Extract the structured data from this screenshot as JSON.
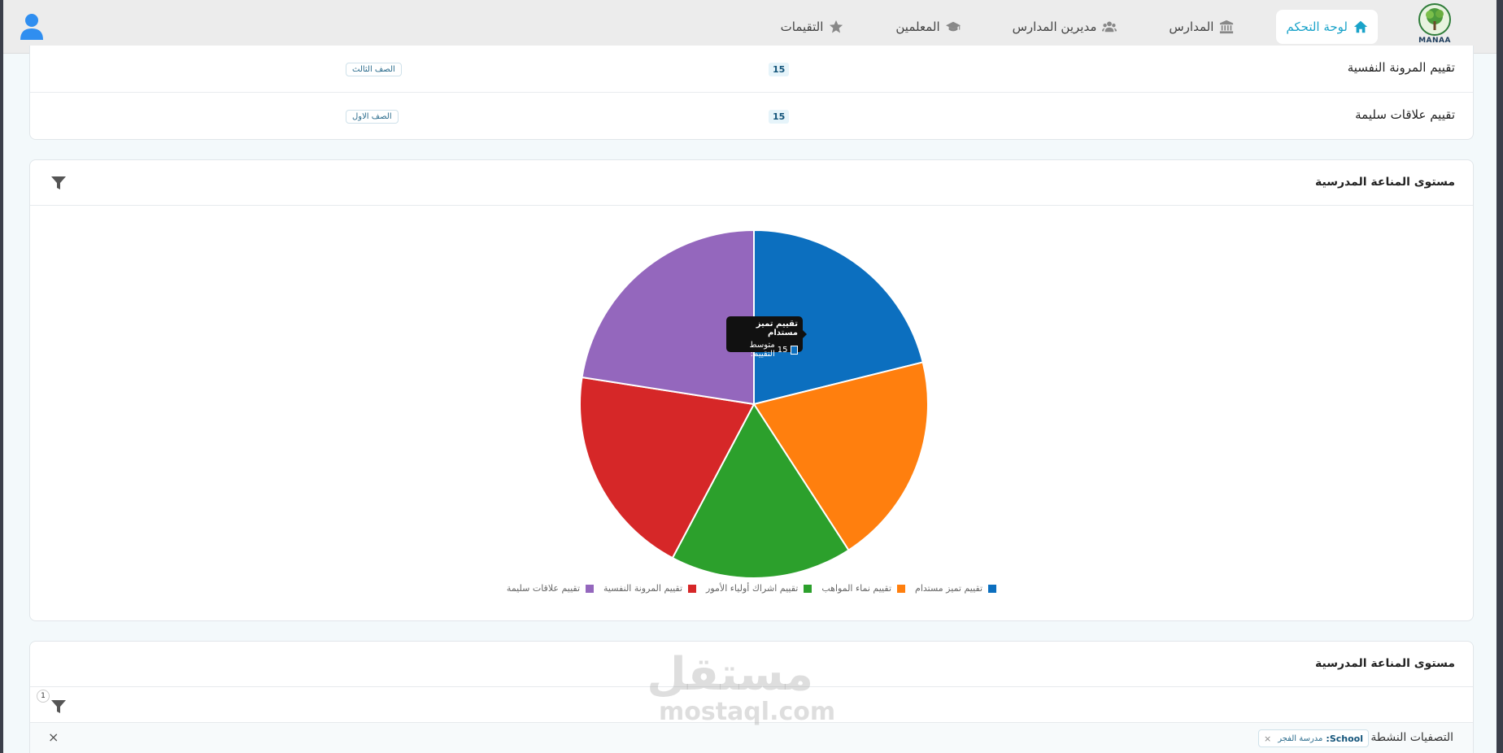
{
  "navbar": {
    "logo_text": "MANAA",
    "items": [
      {
        "label": "لوحة التحكم",
        "icon": "home-icon",
        "active": true
      },
      {
        "label": "المدارس",
        "icon": "school-building-icon",
        "active": false
      },
      {
        "label": "مديرين المدارس",
        "icon": "users-icon",
        "active": false
      },
      {
        "label": "المعلمين",
        "icon": "graduation-cap-icon",
        "active": false
      },
      {
        "label": "التقيمات",
        "icon": "star-icon",
        "active": false
      }
    ],
    "user_icon": "user-icon"
  },
  "table": {
    "rows": [
      {
        "name": "تقييم المرونة النفسية",
        "count": "15",
        "grade": "الصف الثالث"
      },
      {
        "name": "تقييم علاقات سليمة",
        "count": "15",
        "grade": "الصف الاول"
      }
    ]
  },
  "chart_card": {
    "title": "مستوى المناعة المدرسية",
    "tooltip": {
      "title": "تقييم تميز مستدام",
      "label": "متوسط التقييم:",
      "value": "15"
    }
  },
  "chart_data": {
    "type": "pie",
    "categories": [
      "تقييم تميز مستدام",
      "تقييم نماء المواهب",
      "تقييم اشراك أولياء الأمور",
      "تقييم المرونة النفسية",
      "تقييم علاقات سليمة"
    ],
    "values": [
      15,
      14,
      12,
      14,
      16
    ],
    "colors": [
      "#0c6fbf",
      "#ff7f0e",
      "#2ca02c",
      "#d62728",
      "#9467bd"
    ],
    "legend": "bottom"
  },
  "bottom_card": {
    "title": "مستوى المناعة المدرسية",
    "filter_count": "1",
    "active_filters_label": "التصفيات النشطة",
    "chip_key": "School:",
    "chip_value": "مدرسة الفجر",
    "chip_remove": "×",
    "clear": "×"
  },
  "watermark": {
    "arabic": "مستقل",
    "latin": "mostaql.com"
  }
}
